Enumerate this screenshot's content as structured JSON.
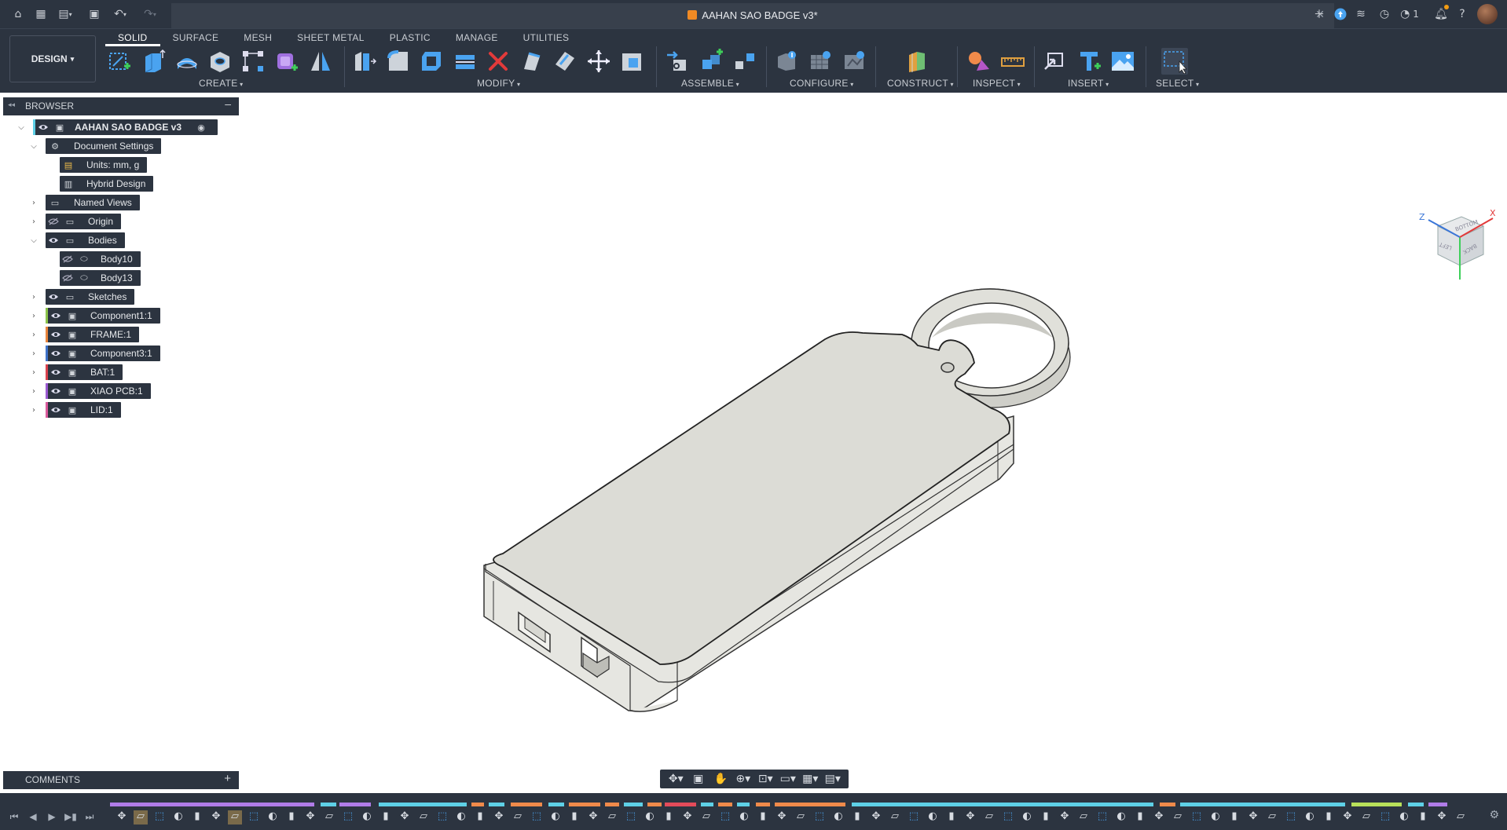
{
  "titlebar": {
    "document_title": "AAHAN SAO BADGE v3*",
    "jobs_count": "1",
    "icons": [
      "home-icon",
      "grid-icon",
      "file-icon",
      "save-icon",
      "undo-icon",
      "redo-icon",
      "close-icon",
      "new-tab-icon",
      "upload-icon",
      "connection-icon",
      "activity-icon",
      "clock-icon",
      "bell-icon",
      "help-icon",
      "avatar"
    ]
  },
  "toolbar": {
    "workspace": "DESIGN",
    "tabs": [
      "SOLID",
      "SURFACE",
      "MESH",
      "SHEET METAL",
      "PLASTIC",
      "MANAGE",
      "UTILITIES"
    ],
    "active_tab": "SOLID",
    "groups": {
      "create": "CREATE",
      "modify": "MODIFY",
      "assemble": "ASSEMBLE",
      "configure": "CONFIGURE",
      "construct": "CONSTRUCT",
      "inspect": "INSPECT",
      "insert": "INSERT",
      "select": "SELECT"
    }
  },
  "browser": {
    "header": "BROWSER",
    "root": "AAHAN SAO BADGE v3",
    "items": [
      {
        "label": "Document Settings",
        "icon": "gear-icon"
      },
      {
        "label": "Units: mm, g",
        "icon": "document-icon"
      },
      {
        "label": "Hybrid Design",
        "icon": "hybrid-icon"
      },
      {
        "label": "Named Views",
        "icon": "folder-icon"
      },
      {
        "label": "Origin",
        "icon": "folder-icon"
      },
      {
        "label": "Bodies",
        "icon": "folder-icon"
      },
      {
        "label": "Body10",
        "icon": "body-icon"
      },
      {
        "label": "Body13",
        "icon": "body-icon"
      },
      {
        "label": "Sketches",
        "icon": "folder-icon"
      },
      {
        "label": "Component1:1",
        "icon": "component-icon",
        "color": "#8bc34a"
      },
      {
        "label": "FRAME:1",
        "icon": "component-icon",
        "color": "#e8843c"
      },
      {
        "label": "Component3:1",
        "icon": "component-icon",
        "color": "#3f72c8"
      },
      {
        "label": "BAT:1",
        "icon": "component-icon",
        "color": "#d9424e"
      },
      {
        "label": "XIAO PCB:1",
        "icon": "component-icon",
        "color": "#9b59d0"
      },
      {
        "label": "LID:1",
        "icon": "component-icon",
        "color": "#d95a9c"
      }
    ]
  },
  "viewcube": {
    "axis_z": "Z",
    "axis_x": "X",
    "faces": [
      "BOTTOM",
      "LEFT",
      "BACK"
    ]
  },
  "comments": {
    "header": "COMMENTS"
  },
  "colors": {
    "chrome": "#2c3440",
    "accent_blue": "#1e90ff",
    "timeline_purple": "#b07ce8",
    "timeline_cyan": "#5ed0e6",
    "timeline_orange": "#f08a4a",
    "timeline_red": "#e34b5a",
    "timeline_lime": "#b8e05a"
  }
}
